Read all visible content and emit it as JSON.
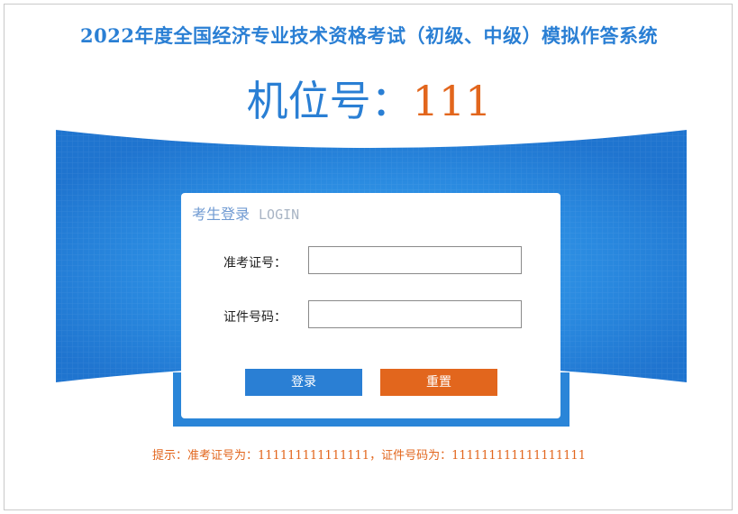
{
  "header": {
    "title": "2022年度全国经济专业技术资格考试（初级、中级）模拟作答系统"
  },
  "machine": {
    "label": "机位号：",
    "number": "111"
  },
  "login": {
    "heading_cn": "考生登录",
    "heading_en": "LOGIN",
    "fields": [
      {
        "label": "准考证号：",
        "value": ""
      },
      {
        "label": "证件号码：",
        "value": ""
      }
    ],
    "login_button": "登录",
    "reset_button": "重置"
  },
  "hint": "提示：准考证号为：111111111111111，证件号码为：111111111111111111",
  "colors": {
    "primary_blue": "#2a7fd4",
    "accent_orange": "#e2661d"
  }
}
